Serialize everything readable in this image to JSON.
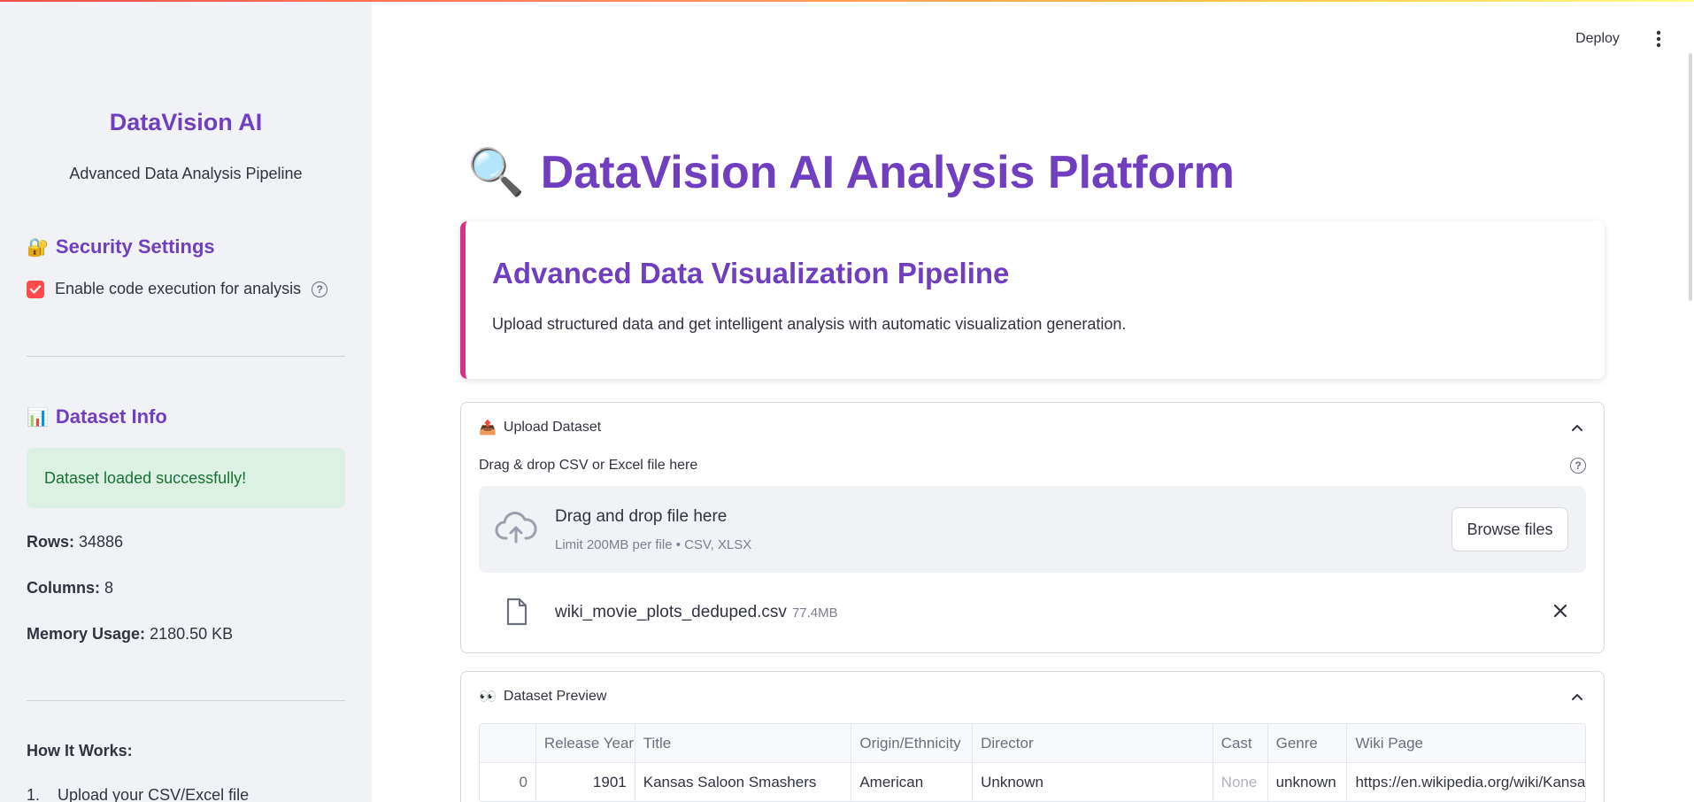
{
  "sidebar": {
    "app_name": "DataVision AI",
    "subtitle": "Advanced Data Analysis Pipeline",
    "security": {
      "emoji": "🔐",
      "heading": "Security Settings",
      "checkbox_label": "Enable code execution for analysis",
      "checked": true
    },
    "dataset": {
      "emoji": "📊",
      "heading": "Dataset Info",
      "success_message": "Dataset loaded successfully!",
      "rows_label": "Rows:",
      "rows_value": "34886",
      "columns_label": "Columns:",
      "columns_value": "8",
      "memory_label": "Memory Usage:",
      "memory_value": "2180.50 KB"
    },
    "how_it_works": {
      "heading": "How It Works:",
      "steps": [
        {
          "num": "1.",
          "text": "Upload your CSV/Excel file"
        }
      ]
    }
  },
  "header": {
    "deploy_label": "Deploy"
  },
  "main": {
    "title_emoji": "🔍",
    "title": "DataVision AI Analysis Platform",
    "card": {
      "heading": "Advanced Data Visualization Pipeline",
      "description": "Upload structured data and get intelligent analysis with automatic visualization generation."
    },
    "upload": {
      "emoji": "📤",
      "heading": "Upload Dataset",
      "label": "Drag & drop CSV or Excel file here",
      "dropzone_title": "Drag and drop file here",
      "dropzone_limit": "Limit 200MB per file • CSV, XLSX",
      "browse_label": "Browse files",
      "file_name": "wiki_movie_plots_deduped.csv",
      "file_size": "77.4MB"
    },
    "preview": {
      "emoji": "👀",
      "heading": "Dataset Preview",
      "columns": [
        "",
        "Release Year",
        "Title",
        "Origin/Ethnicity",
        "Director",
        "Cast",
        "Genre",
        "Wiki Page"
      ],
      "rows": [
        [
          "0",
          "1901",
          "Kansas Saloon Smashers",
          "American",
          "Unknown",
          "None",
          "unknown",
          "https://en.wikipedia.org/wiki/Kansas_Saloon_Smashers"
        ]
      ]
    }
  },
  "colors": {
    "accent_purple": "#6f3fbf",
    "checkbox_red": "#ff4b4b",
    "card_border_pink": "#d63384",
    "success_bg": "#dcf0e4",
    "success_text": "#177233",
    "sidebar_bg": "#f0f2f6"
  }
}
